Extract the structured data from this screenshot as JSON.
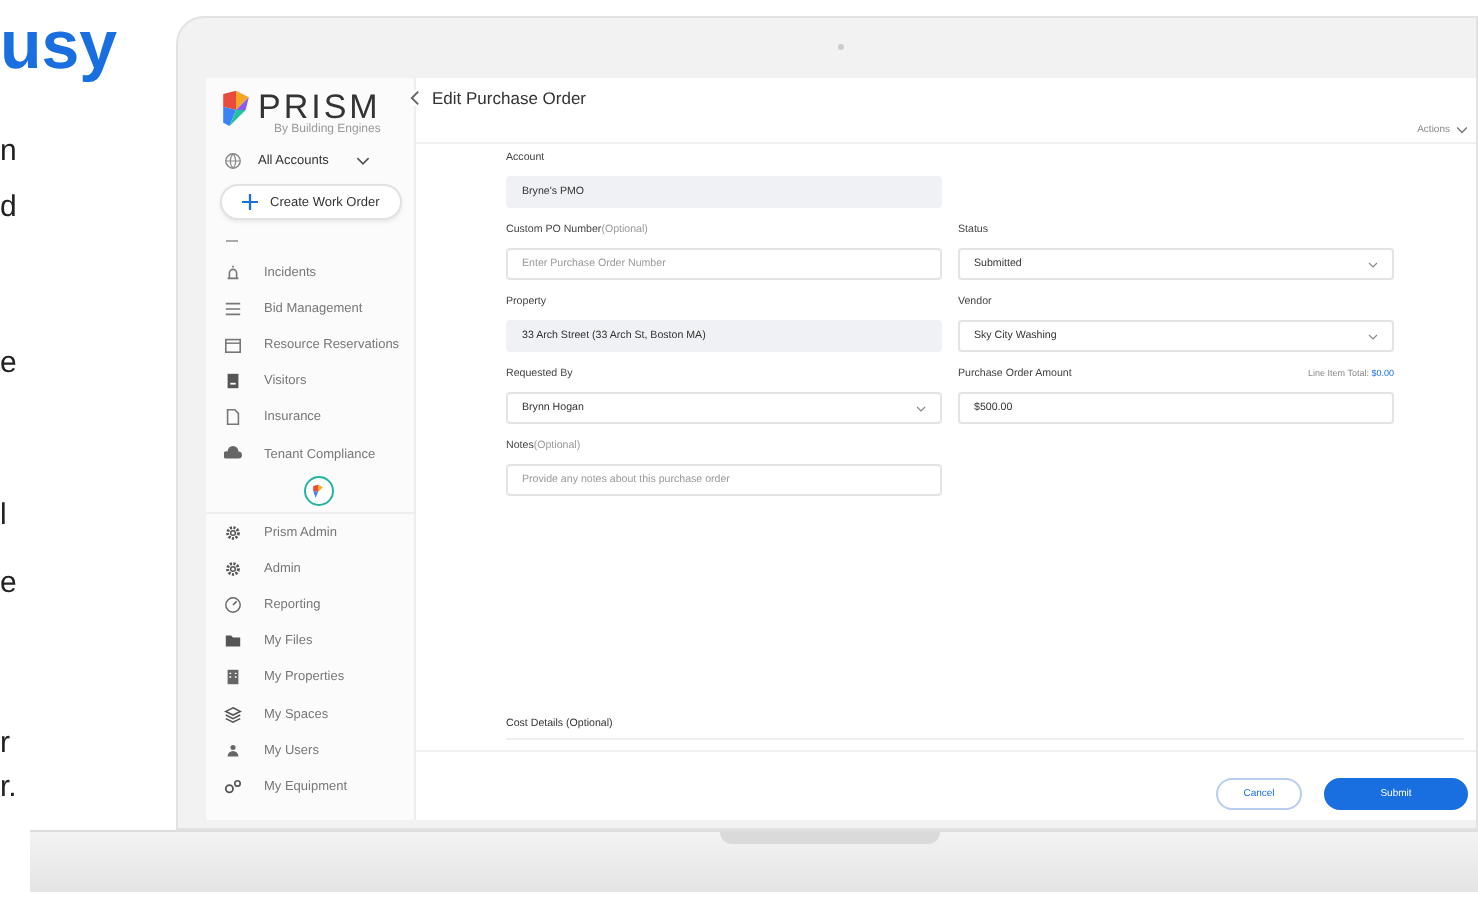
{
  "side_text": {
    "heading": "usy",
    "fragments": [
      "n",
      "d",
      "e",
      "l",
      "e",
      "r",
      "r."
    ]
  },
  "sidebar": {
    "logo": {
      "name": "PRISM",
      "tagline": "By Building Engines"
    },
    "account_selector": "All Accounts",
    "create_button": "Create Work Order",
    "items": [
      {
        "label": "Incidents"
      },
      {
        "label": "Bid Management"
      },
      {
        "label": "Resource Reservations"
      },
      {
        "label": "Visitors"
      },
      {
        "label": "Insurance"
      },
      {
        "label": "Tenant Compliance"
      }
    ],
    "admin_items": [
      {
        "label": "Prism Admin"
      },
      {
        "label": "Admin"
      },
      {
        "label": "Reporting"
      },
      {
        "label": "My Files"
      },
      {
        "label": "My Properties"
      },
      {
        "label": "My Spaces"
      },
      {
        "label": "My Users"
      },
      {
        "label": "My Equipment"
      }
    ]
  },
  "header": {
    "title": "Edit Purchase Order",
    "actions": "Actions"
  },
  "form": {
    "rows": [
      [
        {
          "label": "Account",
          "kind": "readonly",
          "value": "Bryne's PMO"
        }
      ],
      [
        {
          "label": "Custom PO Number",
          "optional": "(Optional)",
          "kind": "input",
          "placeholder": "Enter Purchase Order Number"
        },
        {
          "label": "Status",
          "kind": "select",
          "value": "Submitted"
        }
      ],
      [
        {
          "label": "Property",
          "kind": "readonly",
          "value": "33 Arch Street (33 Arch St, Boston MA)"
        },
        {
          "label": "Vendor",
          "kind": "select",
          "value": "Sky City Washing"
        }
      ],
      [
        {
          "label": "Requested By",
          "kind": "select",
          "value": "Brynn Hogan"
        },
        {
          "label": "Purchase Order Amount",
          "kind": "input",
          "value": "$500.00",
          "note": "Line Item Total:",
          "note_value": "$0.00"
        }
      ],
      [
        {
          "label": "Notes",
          "optional": "(Optional)",
          "kind": "input",
          "placeholder": "Provide any notes about this purchase order"
        }
      ]
    ],
    "cost_details": "Cost Details (Optional)"
  },
  "footer": {
    "buttons": [
      {
        "label": "Cancel",
        "kind": "secondary"
      },
      {
        "label": "Submit",
        "kind": "primary"
      }
    ]
  }
}
